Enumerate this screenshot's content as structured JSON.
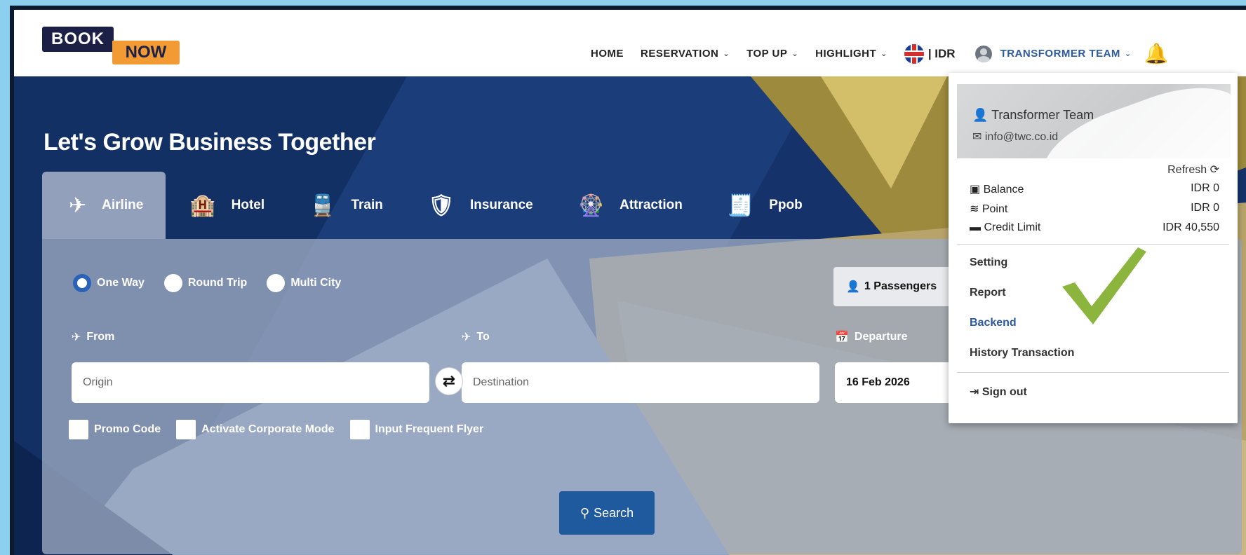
{
  "logo": {
    "top": "BOOK",
    "bottom": "NOW"
  },
  "nav": {
    "home": "HOME",
    "reservation": "RESERVATION",
    "topup": "TOP UP",
    "highlight": "HIGHLIGHT",
    "currency": "| IDR",
    "user": "TRANSFORMER TEAM",
    "chevron": "⌄",
    "icons": {
      "flag": "uk-flag-icon",
      "user": "user-avatar-icon",
      "bell": "bell-icon"
    }
  },
  "hero": {
    "title": "Let's Grow Business Together"
  },
  "tabs": [
    {
      "label": "Airline",
      "icon": "✈"
    },
    {
      "label": "Hotel",
      "icon": "🏨"
    },
    {
      "label": "Train",
      "icon": "🚆"
    },
    {
      "label": "Insurance",
      "icon": "🛡"
    },
    {
      "label": "Attraction",
      "icon": "🎡"
    },
    {
      "label": "Ppob",
      "icon": "🧾"
    }
  ],
  "search": {
    "trip_types": [
      "One Way",
      "Round Trip",
      "Multi City"
    ],
    "passengers": "1 Passengers",
    "from_label": "From",
    "to_label": "To",
    "departure_label": "Departure",
    "origin_placeholder": "Origin",
    "destination_placeholder": "Destination",
    "departure_value": "16 Feb 2026",
    "options": [
      "Promo Code",
      "Activate Corporate Mode",
      "Input Frequent Flyer"
    ],
    "button": "Search"
  },
  "account": {
    "name": "Transformer Team",
    "email": "info@twc.co.id",
    "refresh": "Refresh",
    "balance_label": "Balance",
    "balance_value": "IDR 0",
    "point_label": "Point",
    "point_value": "IDR 0",
    "credit_label": "Credit Limit",
    "credit_value": "IDR 40,550",
    "menu": {
      "setting": "Setting",
      "report": "Report",
      "backend": "Backend",
      "history": "History Transaction",
      "signout": "Sign out"
    }
  },
  "colors": {
    "accent_blue": "#2c5aa0",
    "logo_dark": "#1c2046",
    "logo_orange": "#f29a33",
    "check_green": "#8bb53c",
    "frame": "#8ccfee"
  }
}
